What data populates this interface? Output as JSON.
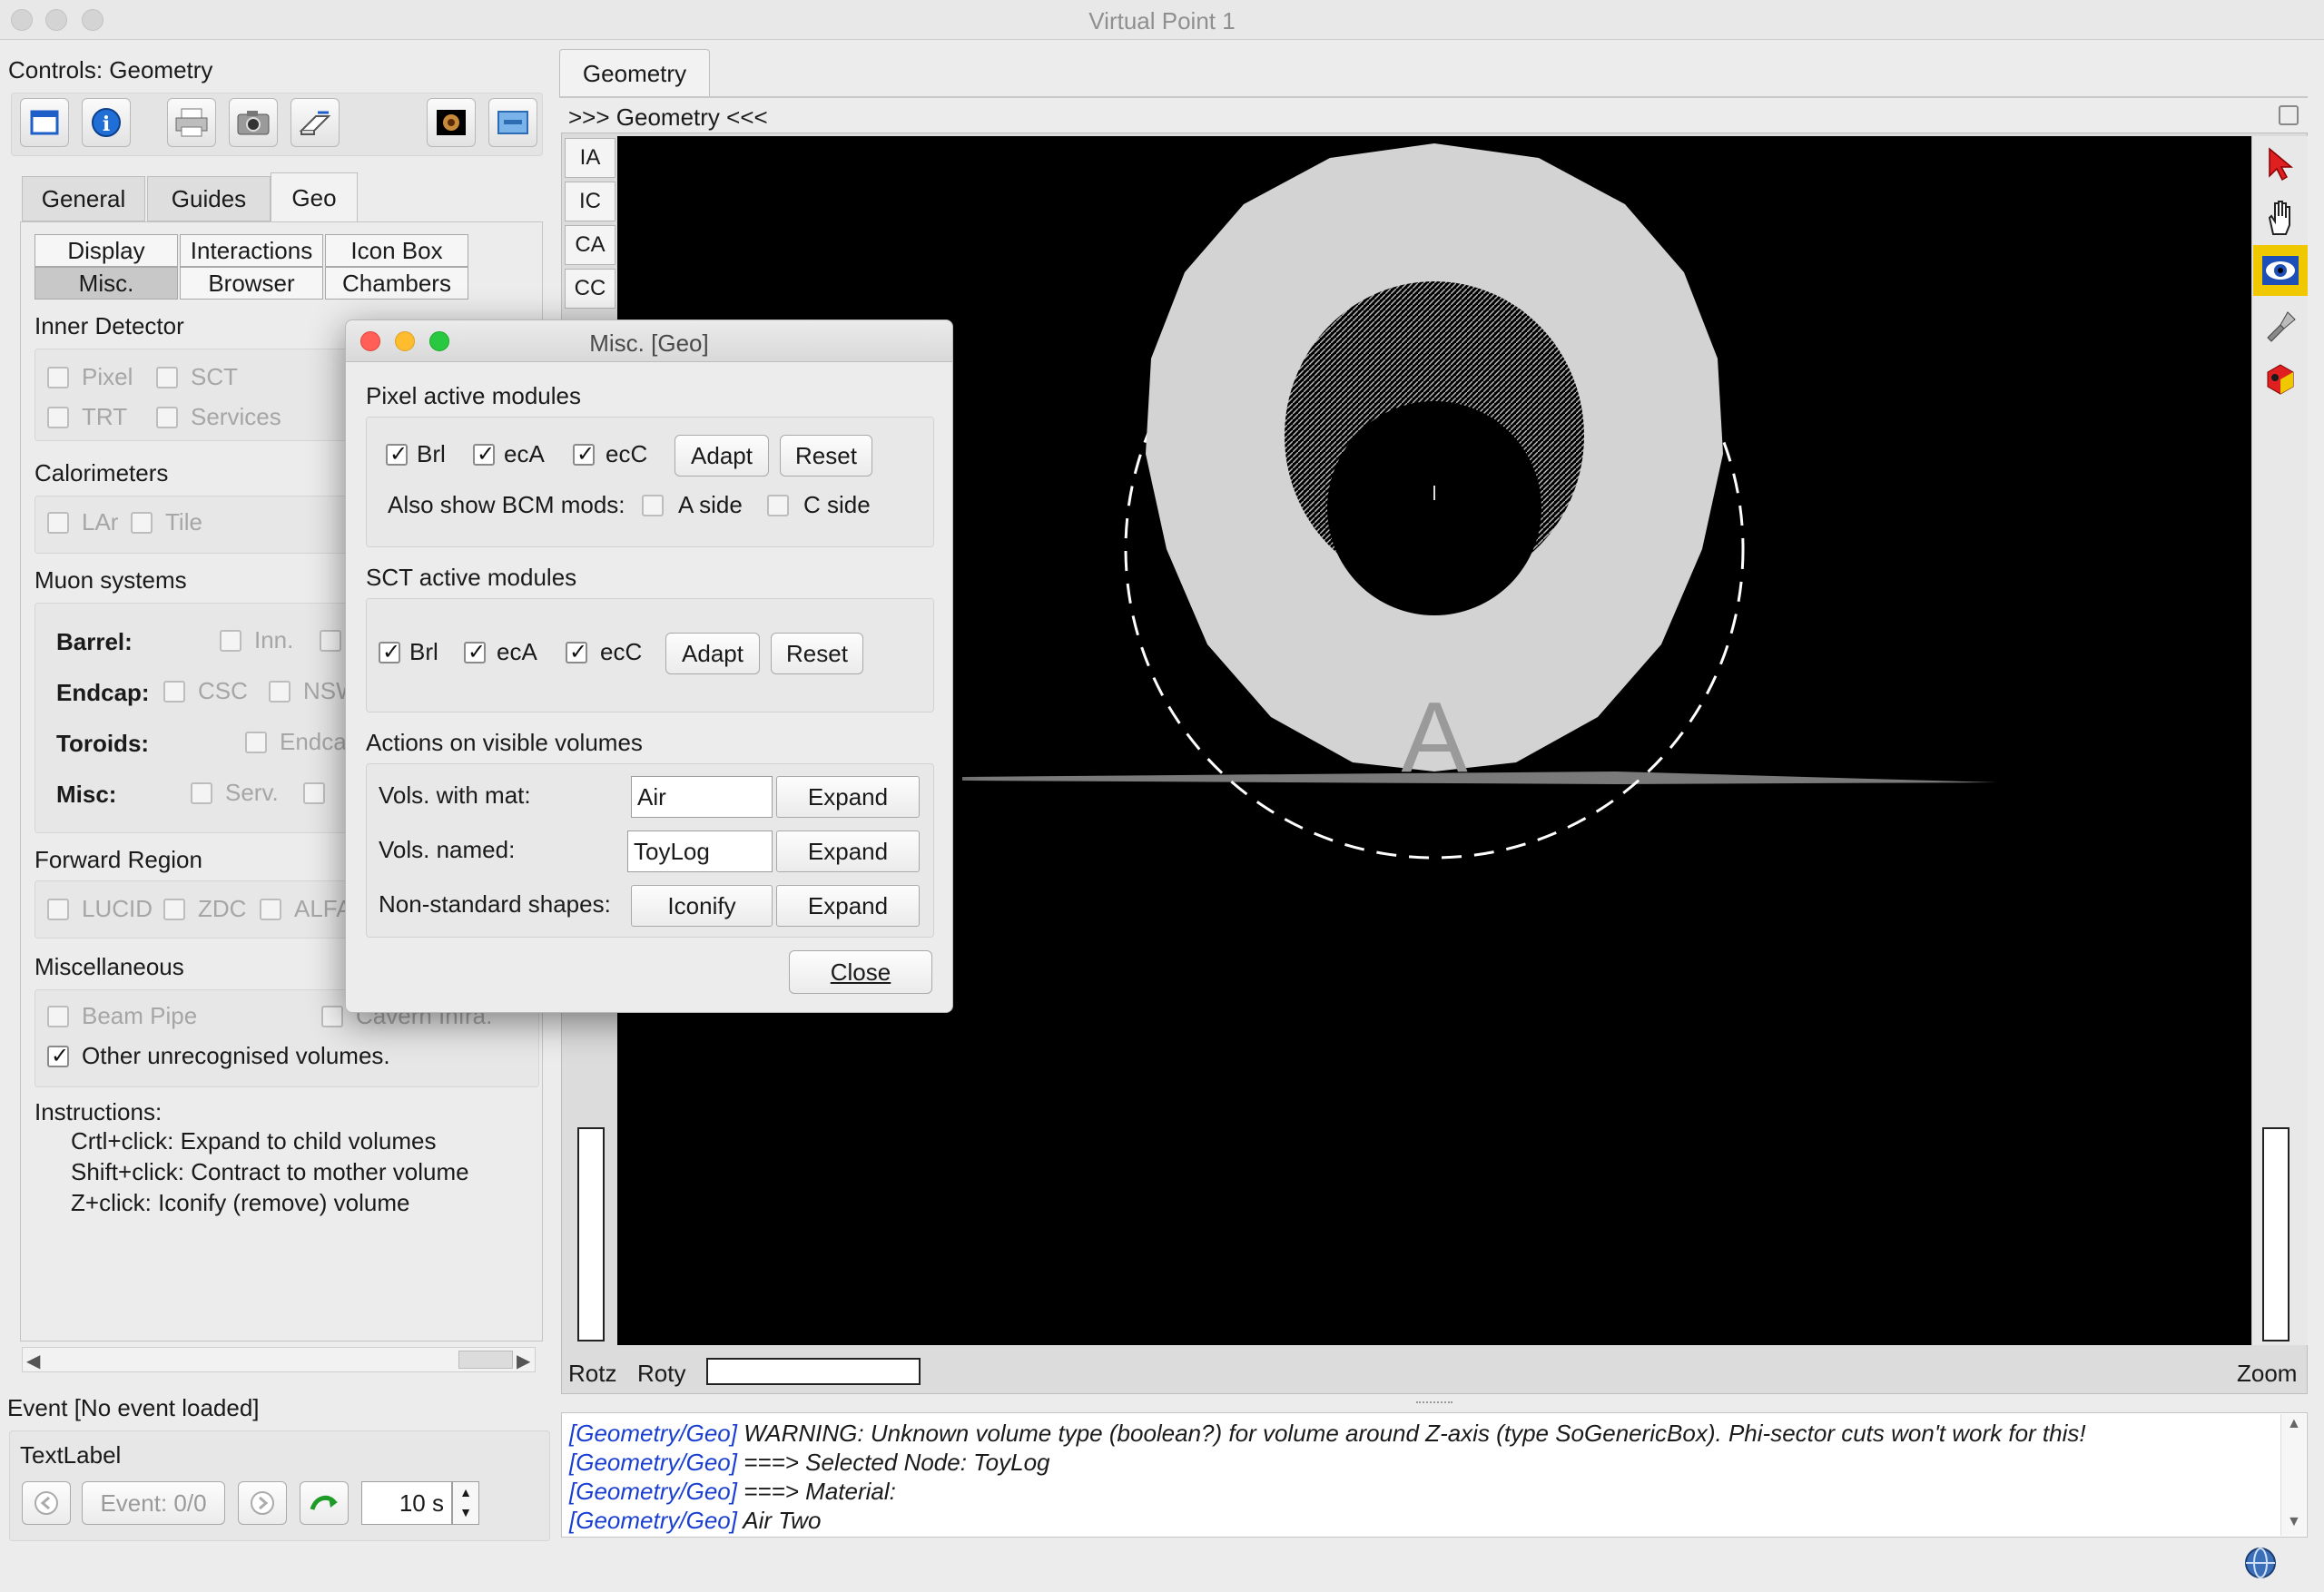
{
  "window": {
    "title": "Virtual Point 1"
  },
  "controls": {
    "title": "Controls: Geometry",
    "toolbar_icons": [
      "window-icon",
      "info-icon",
      "print-icon",
      "camera-icon",
      "export-icon",
      "snapshot-icon",
      "screen-icon"
    ],
    "tabs": [
      "General",
      "Guides",
      "Geo"
    ],
    "active_tab": "Geo",
    "subtabs": [
      "Display",
      "Interactions",
      "Icon Box",
      "Misc.",
      "Browser",
      "Chambers"
    ],
    "active_subtab": "Misc.",
    "inner_detector": {
      "title": "Inner Detector",
      "items": [
        "Pixel",
        "SCT",
        "TRT",
        "Services"
      ]
    },
    "calorimeters": {
      "title": "Calorimeters",
      "items": [
        "LAr",
        "Tile"
      ]
    },
    "muon": {
      "title": "Muon systems",
      "barrel_label": "Barrel:",
      "barrel_items": [
        "Inn."
      ],
      "endcap_label": "Endcap:",
      "endcap_items": [
        "CSC",
        "NSW"
      ],
      "toroids_label": "Toroids:",
      "toroids_items": [
        "Endca"
      ],
      "misc_label": "Misc:",
      "misc_items": [
        "Serv."
      ]
    },
    "forward": {
      "title": "Forward Region",
      "items": [
        "LUCID",
        "ZDC",
        "ALFA"
      ]
    },
    "miscellaneous": {
      "title": "Miscellaneous",
      "items": [
        "Beam Pipe",
        "Cavern Infra.",
        "Other unrecognised volumes."
      ]
    },
    "instructions": {
      "title": "Instructions:",
      "lines": [
        "Crtl+click: Expand to child volumes",
        "Shift+click: Contract to mother volume",
        "Z+click: Iconify (remove) volume"
      ]
    },
    "event": {
      "header": "Event [No event loaded]",
      "text_label": "TextLabel",
      "event_counter": "Event: 0/0",
      "interval": "10 s"
    }
  },
  "viewer": {
    "tab": "Geometry",
    "header": ">>> Geometry <<<",
    "camera_tabs": [
      "IA",
      "IC",
      "CA",
      "CC"
    ],
    "tools": [
      "select-arrow-icon",
      "hand-icon",
      "eye-icon",
      "flashlight-icon",
      "view-all-icon"
    ],
    "bottom": {
      "rotz": "Rotz",
      "roty": "Roty",
      "zoom": "Zoom"
    },
    "colors": {
      "background": "#000000",
      "ring": "#d3d3d3"
    }
  },
  "log": [
    {
      "src": "[Geometry/Geo]",
      "msg": "WARNING: Unknown volume type (boolean?) for volume around Z-axis (type SoGenericBox). Phi-sector cuts won't work for this!"
    },
    {
      "src": "[Geometry/Geo]",
      "msg": "===> Selected Node: ToyLog"
    },
    {
      "src": "[Geometry/Geo]",
      "msg": "===> Material:"
    },
    {
      "src": "[Geometry/Geo]",
      "msg": "Air Two"
    }
  ],
  "dialog": {
    "title": "Misc. [Geo]",
    "pixel": {
      "title": "Pixel active modules",
      "brl": "Brl",
      "eca": "ecA",
      "ecc": "ecC",
      "adapt": "Adapt",
      "reset": "Reset",
      "bcm_label": "Also show BCM mods:",
      "a_side": "A side",
      "c_side": "C side"
    },
    "sct": {
      "title": "SCT active modules",
      "brl": "Brl",
      "eca": "ecA",
      "ecc": "ecC",
      "adapt": "Adapt",
      "reset": "Reset"
    },
    "actions": {
      "title": "Actions on visible volumes",
      "mat_label": "Vols. with mat:",
      "mat_value": "Air",
      "named_label": "Vols. named:",
      "named_value": "ToyLog",
      "nonstd_label": "Non-standard shapes:",
      "iconify": "Iconify",
      "expand": "Expand"
    },
    "close": "Close"
  }
}
